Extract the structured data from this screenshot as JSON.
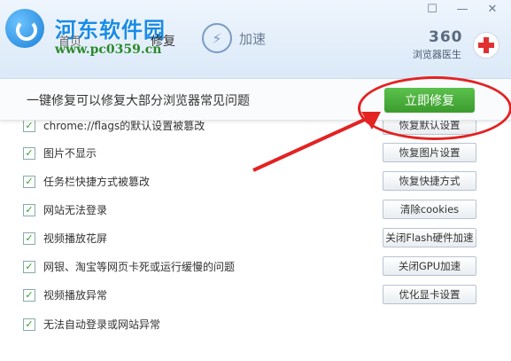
{
  "watermark": {
    "title": "河东软件园",
    "url": "www.pc0359.cn"
  },
  "nav": {
    "home": "首页",
    "repair": "修复",
    "accel": "加速"
  },
  "brand": {
    "logo": "360",
    "subtitle": "浏览器医生"
  },
  "window_controls": [
    "☐",
    "—",
    "✕"
  ],
  "banner": {
    "text": "一键修复可以修复大部分浏览器常见问题",
    "button": "立即修复"
  },
  "items": [
    {
      "label": "chrome://flags的默认设置被篡改",
      "button": "恢复默认设置",
      "checked": true
    },
    {
      "label": "图片不显示",
      "button": "恢复图片设置",
      "checked": true
    },
    {
      "label": "任务栏快捷方式被篡改",
      "button": "恢复快捷方式",
      "checked": true
    },
    {
      "label": "网站无法登录",
      "button": "清除cookies",
      "checked": true
    },
    {
      "label": "视频播放花屏",
      "button": "关闭Flash硬件加速",
      "checked": true
    },
    {
      "label": "网银、淘宝等网页卡死或运行缓慢的问题",
      "button": "关闭GPU加速",
      "checked": true
    },
    {
      "label": "视频播放异常",
      "button": "优化显卡设置",
      "checked": true
    },
    {
      "label": "无法自动登录或网站异常",
      "button": "",
      "checked": true
    }
  ],
  "colors": {
    "accent_green": "#3b9c2e",
    "annotation_red": "#e32222",
    "watermark_blue": "#1a8ce6"
  }
}
